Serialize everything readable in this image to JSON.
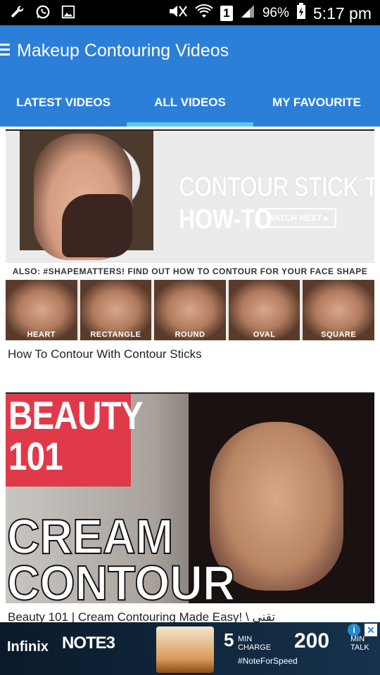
{
  "status_bar": {
    "battery_pct": "96%",
    "time": "5:17 pm",
    "sim_label": "1",
    "left_icons": [
      "wrench-icon",
      "whatsapp-icon",
      "image-icon"
    ],
    "right_icons": [
      "mute-icon",
      "wifi-icon",
      "signal-icon",
      "battery-icon"
    ]
  },
  "app_bar": {
    "title": "Makeup Contouring Videos",
    "menu_icon": "hamburger-icon",
    "accent": "#2b7fd9",
    "indicator_color": "#5fc8ee"
  },
  "tabs": [
    {
      "label": "LATEST VIDEOS",
      "active": false
    },
    {
      "label": "ALL VIDEOS",
      "active": true
    },
    {
      "label": "MY FAVOURITE",
      "active": false
    }
  ],
  "videos": [
    {
      "title": "How To Contour With Contour Sticks",
      "thumbnail": {
        "heading_line1": "CONTOUR STICK TRIO",
        "heading_line2": "HOW-TO",
        "button_text": "WATCH NEXT ▸",
        "band_text": "ALSO: #SHAPEMATTERS! FIND OUT HOW TO CONTOUR FOR YOUR FACE SHAPE",
        "face_shapes": [
          "HEART",
          "RECTANGLE",
          "ROUND",
          "OVAL",
          "SQUARE"
        ]
      }
    },
    {
      "title": "Beauty 101 | Cream Contouring Made Easy! \\ تقني",
      "thumbnail": {
        "beauty_line1": "BEAUTY",
        "beauty_line2": "101",
        "cream_line1": "CREAM",
        "cream_line2": "CONTOUR"
      }
    }
  ],
  "ad": {
    "brand": "Infinix",
    "model": "NOTE3",
    "charge_value": "5",
    "charge_label_1": "MIN",
    "charge_label_2": "CHARGE",
    "talk_value": "200",
    "talk_label_1": "MIN",
    "talk_label_2": "TALK",
    "hashtag": "#NoteForSpeed",
    "info_symbol": "i",
    "close_symbol": "✕"
  }
}
